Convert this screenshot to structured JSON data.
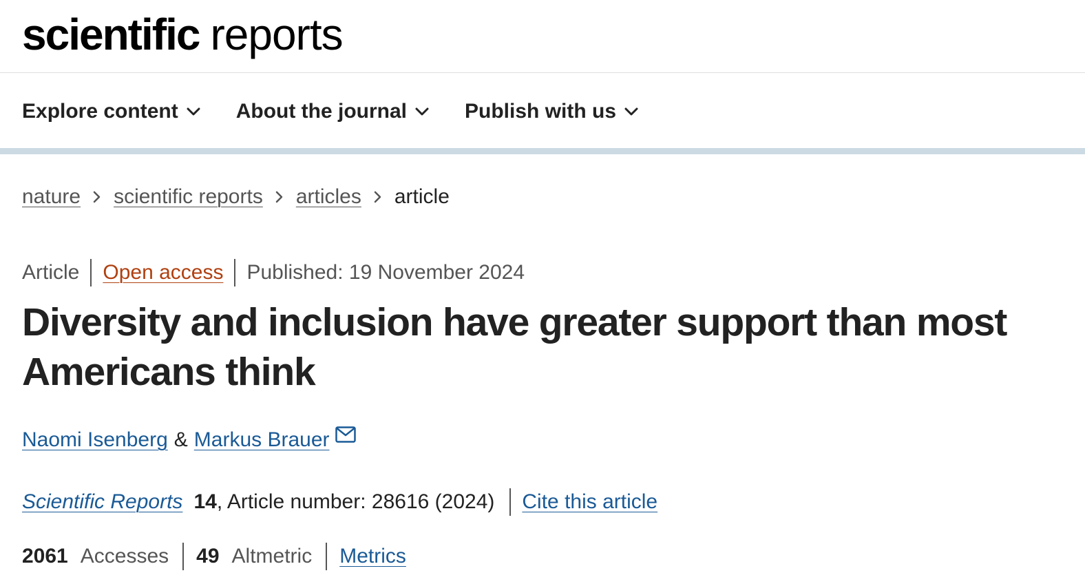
{
  "header": {
    "logo_bold": "scientific",
    "logo_light": "reports"
  },
  "nav": {
    "items": [
      {
        "label": "Explore content",
        "icon": "chevron-down-icon"
      },
      {
        "label": "About the journal",
        "icon": "chevron-down-icon"
      },
      {
        "label": "Publish with us",
        "icon": "chevron-down-icon"
      }
    ]
  },
  "breadcrumb": {
    "items": [
      {
        "label": "nature"
      },
      {
        "label": "scientific reports"
      },
      {
        "label": "articles"
      }
    ],
    "current": "article",
    "separator_icon": "chevron-right-icon"
  },
  "article": {
    "type": "Article",
    "access": "Open access",
    "published": "Published: 19 November 2024",
    "title": "Diversity and inclusion have greater support than most Americans think",
    "authors": [
      {
        "name": "Naomi Isenberg"
      },
      {
        "name": "Markus Brauer",
        "icon": "mail-icon"
      }
    ],
    "author_separator": "&",
    "journal": "Scientific Reports",
    "volume": "14",
    "article_number": ", Article number: 28616 (2024)",
    "cite_label": "Cite this article"
  },
  "metrics": {
    "accesses_count": "2061",
    "accesses_label": "Accesses",
    "altmetric_count": "49",
    "altmetric_label": "Altmetric",
    "metrics_link": "Metrics"
  },
  "colors": {
    "text": "#222222",
    "muted": "#555555",
    "link": "#1a5a96",
    "open_access": "#b04010",
    "nav_rule": "#ccdae3"
  }
}
